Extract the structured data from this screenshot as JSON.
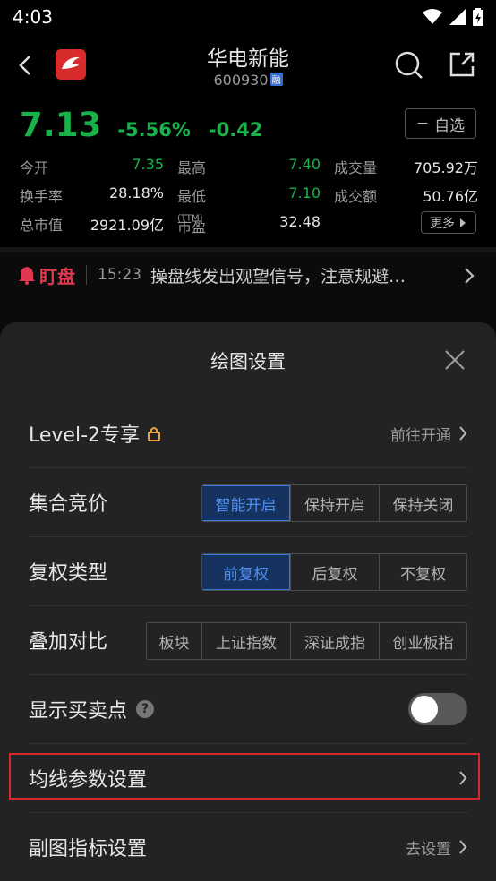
{
  "status": {
    "time": "4:03"
  },
  "header": {
    "title": "华电新能",
    "code": "600930",
    "rong_badge": "融"
  },
  "quote": {
    "price": "7.13",
    "pct": "-5.56%",
    "chg": "-0.42",
    "watch_label": "自选",
    "watch_icon": "−"
  },
  "stats": {
    "open_label": "今开",
    "open": "7.35",
    "high_label": "最高",
    "high": "7.40",
    "vol_label": "成交量",
    "vol": "705.92万",
    "turnover_label": "换手率",
    "turnover": "28.18%",
    "low_label": "最低",
    "low": "7.10",
    "amount_label": "成交额",
    "amount": "50.76亿",
    "mcap_label": "总市值",
    "mcap": "2921.09亿",
    "pe_label": "市盈",
    "pe_sup": "(TTM)",
    "pe": "32.48",
    "more_label": "更多"
  },
  "dingpan": {
    "logo": "盯盘",
    "time": "15:23",
    "text": "操盘线发出观望信号，注意规避…"
  },
  "sheet": {
    "title": "绘图设置",
    "level2": {
      "label": "Level-2专享",
      "action": "前往开通"
    },
    "auction": {
      "label": "集合竞价",
      "options": [
        "智能开启",
        "保持开启",
        "保持关闭"
      ],
      "selected": "智能开启"
    },
    "adjust": {
      "label": "复权类型",
      "options": [
        "前复权",
        "后复权",
        "不复权"
      ],
      "selected": "前复权"
    },
    "overlay": {
      "label": "叠加对比",
      "options": [
        "板块",
        "上证指数",
        "深证成指",
        "创业板指"
      ]
    },
    "buysell": {
      "label": "显示买卖点",
      "help": "?",
      "enabled": false
    },
    "ma": {
      "label": "均线参数设置"
    },
    "sub": {
      "label": "副图指标设置",
      "action": "去设置"
    }
  },
  "colors": {
    "down": "#19b24a",
    "accent": "#4f8ef0",
    "alert": "#d42a2a"
  }
}
